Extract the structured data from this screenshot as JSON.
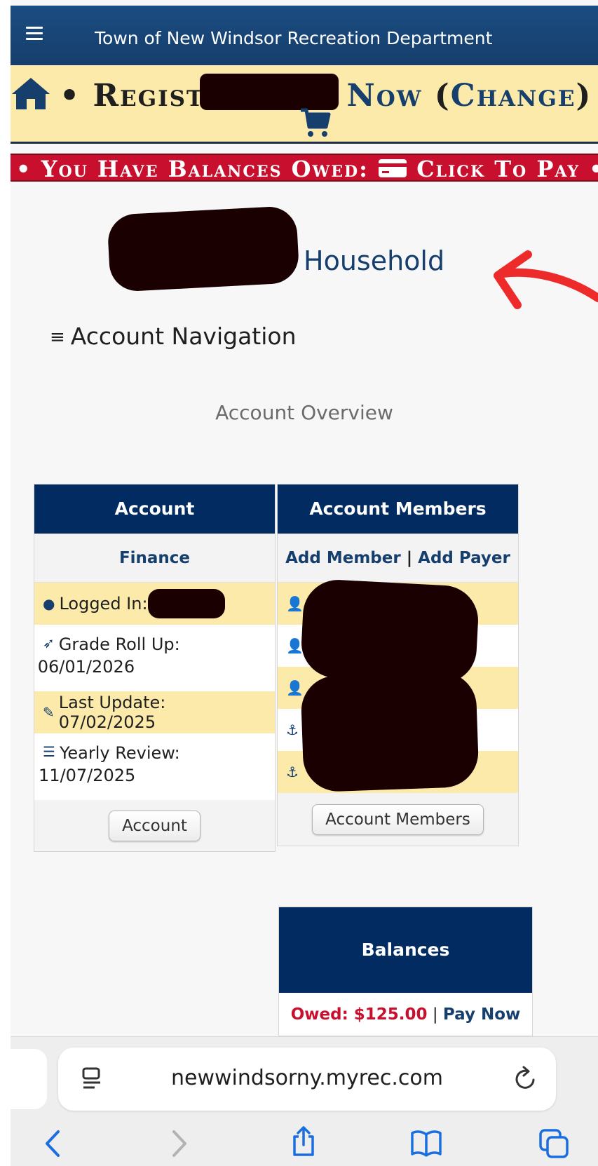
{
  "header": {
    "title": "Town of New Windsor Recreation Department"
  },
  "register_bar": {
    "register_label": "• Register",
    "now_label": "Now",
    "change_open": "(",
    "change_label": "Change",
    "change_close": ")",
    "trailing": "•"
  },
  "balance_bar": {
    "owed_label": "• You Have Balances Owed:",
    "pay_label": "Click To Pay •"
  },
  "household": {
    "label": "Household"
  },
  "account_nav": {
    "label": "Account Navigation"
  },
  "overview": {
    "title": "Account Overview"
  },
  "account_card": {
    "header": "Account",
    "finance_link": "Finance",
    "logged_in_label": "Logged In:",
    "grade_roll_up_label": "Grade Roll Up:",
    "grade_roll_up_date": "06/01/2026",
    "last_update_label": "Last Update: 07/02/2025",
    "yearly_review_label": "Yearly Review:",
    "yearly_review_date": "11/07/2025",
    "button": "Account"
  },
  "members_card": {
    "header": "Account Members",
    "add_member": "Add Member",
    "separator": "|",
    "add_payer": "Add Payer",
    "button": "Account Members"
  },
  "balances_card": {
    "header": "Balances",
    "owed": "Owed: $125.00",
    "separator": "|",
    "pay_now": "Pay Now"
  },
  "browser": {
    "url": "newwindsorny.myrec.com"
  },
  "colors": {
    "navy": "#022b62",
    "header_blue": "#1b4c82",
    "accent_yellow": "#fbeaaa",
    "alert_red": "#c8102e",
    "link_blue": "#163f6d"
  }
}
